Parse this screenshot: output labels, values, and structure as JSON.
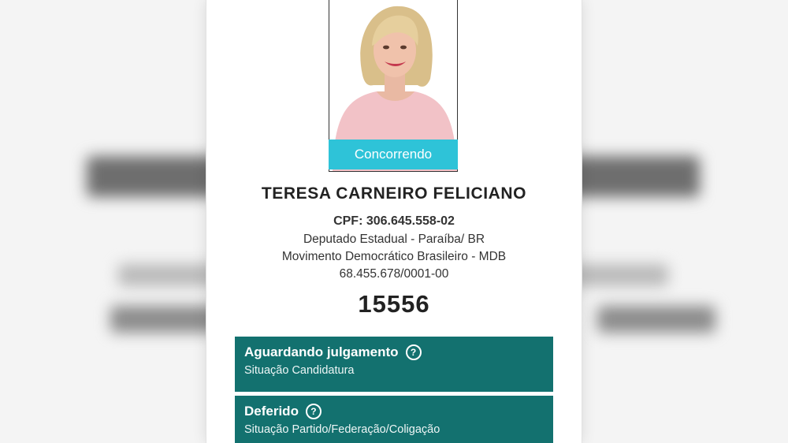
{
  "candidate": {
    "status": "Concorrendo",
    "name": "TERESA CARNEIRO FELICIANO",
    "cpf": "CPF: 306.645.558-02",
    "role": "Deputado Estadual - Paraíba/ BR",
    "party": "Movimento Democrático Brasileiro - MDB",
    "cnpj": "68.455.678/0001-00",
    "number": "15556"
  },
  "situations": [
    {
      "title": "Aguardando julgamento",
      "subtitle": "Situação Candidatura"
    },
    {
      "title": "Deferido",
      "subtitle": "Situação Partido/Federação/Coligação"
    }
  ],
  "icons": {
    "help": "question-circle-icon"
  },
  "colors": {
    "status_pill": "#2ec3d8",
    "situation_box": "#13716f"
  }
}
